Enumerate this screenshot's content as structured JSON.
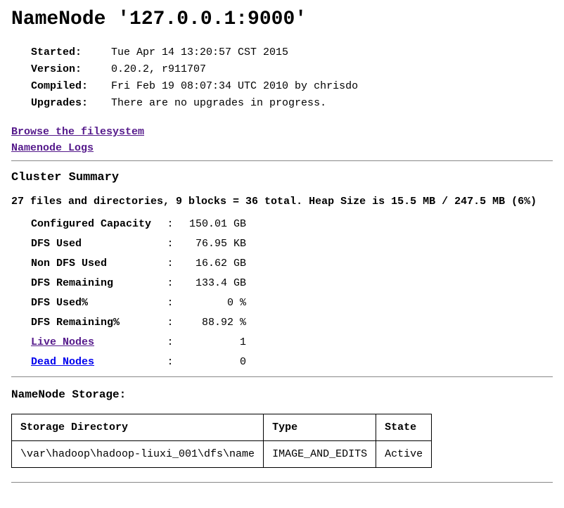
{
  "page_title": "NameNode '127.0.0.1:9000'",
  "info": {
    "started_label": "Started:",
    "started_value": "Tue Apr 14 13:20:57 CST 2015",
    "version_label": "Version:",
    "version_value": "0.20.2, r911707",
    "compiled_label": "Compiled:",
    "compiled_value": "Fri Feb 19 08:07:34 UTC 2010 by chrisdo",
    "upgrades_label": "Upgrades:",
    "upgrades_value": "There are no upgrades in progress."
  },
  "links": {
    "browse_fs": "Browse the filesystem",
    "namenode_logs": "Namenode Logs"
  },
  "cluster": {
    "heading": "Cluster Summary",
    "summary_line": "27 files and directories, 9 blocks = 36 total. Heap Size is 15.5 MB / 247.5 MB (6%)",
    "rows": {
      "configured_capacity_label": "Configured Capacity",
      "configured_capacity_value": "150.01 GB",
      "dfs_used_label": "DFS Used",
      "dfs_used_value": "76.95 KB",
      "non_dfs_used_label": "Non DFS Used",
      "non_dfs_used_value": "16.62 GB",
      "dfs_remaining_label": "DFS Remaining",
      "dfs_remaining_value": "133.4 GB",
      "dfs_used_pct_label": "DFS Used%",
      "dfs_used_pct_value": "0 %",
      "dfs_remaining_pct_label": "DFS Remaining%",
      "dfs_remaining_pct_value": "88.92 %",
      "live_nodes_label": "Live Nodes",
      "live_nodes_value": "1",
      "dead_nodes_label": "Dead Nodes",
      "dead_nodes_value": "0"
    }
  },
  "storage": {
    "heading": "NameNode Storage:",
    "headers": {
      "dir": "Storage Directory",
      "type": "Type",
      "state": "State"
    },
    "row": {
      "dir": "\\var\\hadoop\\hadoop-liuxi_001\\dfs\\name",
      "type": "IMAGE_AND_EDITS",
      "state": "Active"
    }
  }
}
